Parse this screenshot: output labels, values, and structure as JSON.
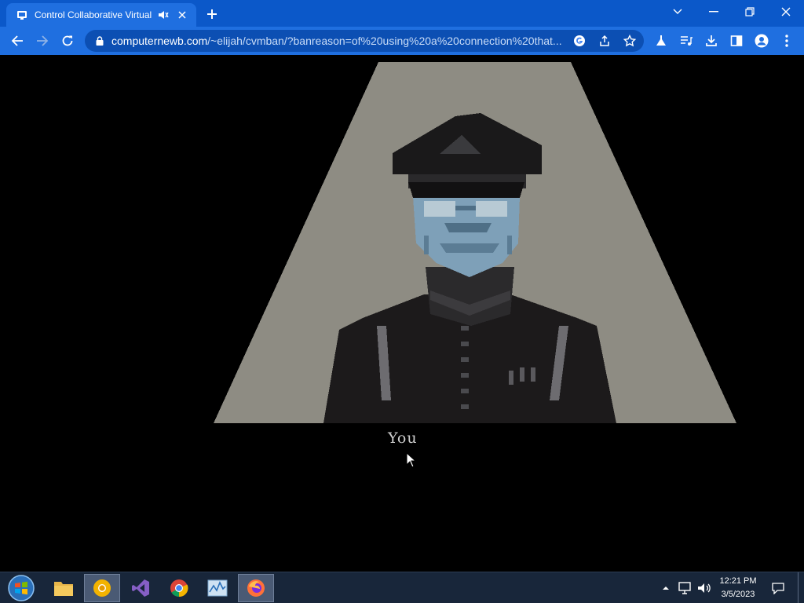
{
  "browser": {
    "tab": {
      "title": "Control Collaborative Virtual Machine",
      "favicon": "cvm-icon"
    },
    "url": {
      "host": "computernewb.com",
      "path": "/~elijah/cvmban/?banreason=of%20using%20a%20connection%20that..."
    },
    "toolbar_icons": [
      "back-icon",
      "forward-icon",
      "reload-icon",
      "lock-icon",
      "google-icon",
      "share-icon",
      "star-icon",
      "labs-icon",
      "media-icon",
      "download-icon",
      "sidepanel-icon",
      "profile-icon",
      "menu-icon"
    ]
  },
  "page": {
    "caption": "You",
    "colors": {
      "background": "#000000",
      "spotlight": "#8e8c83",
      "uniform": "#1c1a1b",
      "face": "#7ea0b8"
    }
  },
  "taskbar": {
    "apps": [
      "start-orb",
      "file-explorer",
      "chrome-canary",
      "visual-studio",
      "chrome",
      "resource-monitor",
      "firefox"
    ],
    "clock": {
      "time": "12:21 PM",
      "date": "3/5/2023"
    }
  }
}
